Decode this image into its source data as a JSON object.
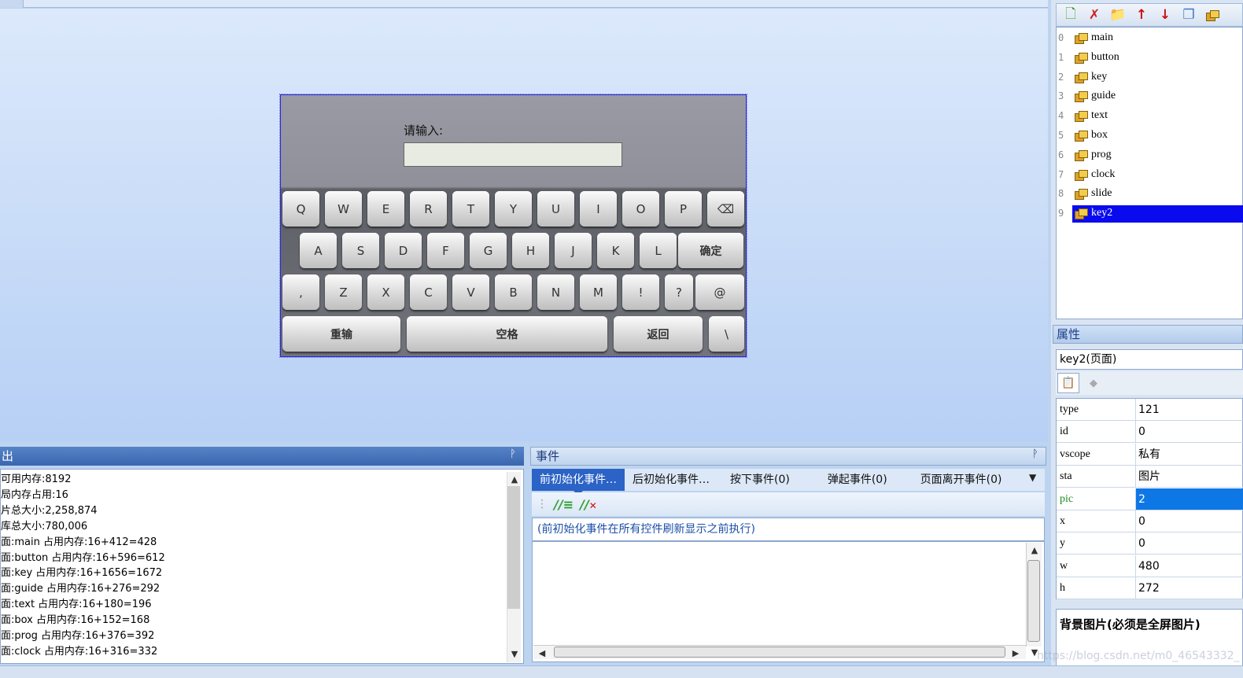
{
  "canvas": {
    "prompt_label": "请输入:",
    "keyboard": {
      "row1": [
        "Q",
        "W",
        "E",
        "R",
        "T",
        "Y",
        "U",
        "I",
        "O",
        "P",
        "⌫"
      ],
      "row2": [
        "A",
        "S",
        "D",
        "F",
        "G",
        "H",
        "J",
        "K",
        "L",
        "确定"
      ],
      "row3": [
        ",",
        "Z",
        "X",
        "C",
        "V",
        "B",
        "N",
        "M",
        "!",
        "?",
        "@"
      ],
      "row4": [
        "重输",
        "空格",
        "返回",
        "\\"
      ]
    }
  },
  "toolbar": {
    "icons": [
      "new-page-icon",
      "delete-page-icon",
      "move-page-icon",
      "arrow-up-icon",
      "arrow-down-icon",
      "copy-page-icon",
      "page-menu-icon"
    ]
  },
  "pages": [
    {
      "index": "0",
      "name": "main"
    },
    {
      "index": "1",
      "name": "button"
    },
    {
      "index": "2",
      "name": "key"
    },
    {
      "index": "3",
      "name": "guide"
    },
    {
      "index": "4",
      "name": "text"
    },
    {
      "index": "5",
      "name": "box"
    },
    {
      "index": "6",
      "name": "prog"
    },
    {
      "index": "7",
      "name": "clock"
    },
    {
      "index": "8",
      "name": "slide"
    },
    {
      "index": "9",
      "name": "key2"
    }
  ],
  "selected_page_index": 9,
  "properties": {
    "title": "属性",
    "selected_object": "key2(页面)",
    "rows": [
      {
        "key": "type",
        "value": "121"
      },
      {
        "key": "id",
        "value": "0"
      },
      {
        "key": "vscope",
        "value": "私有"
      },
      {
        "key": "sta",
        "value": "图片"
      },
      {
        "key": "pic",
        "value": "2"
      },
      {
        "key": "x",
        "value": "0"
      },
      {
        "key": "y",
        "value": "0"
      },
      {
        "key": "w",
        "value": "480"
      },
      {
        "key": "h",
        "value": "272"
      }
    ],
    "selected_row": 4,
    "description": "背景图片(必须是全屏图片)"
  },
  "output": {
    "title": "出",
    "pin": "ᚹ",
    "lines": [
      "可用内存:8192",
      "局内存占用:16",
      "片总大小:2,258,874",
      "库总大小:780,006",
      "面:main 占用内存:16+412=428",
      "面:button 占用内存:16+596=612",
      "面:key 占用内存:16+1656=1672",
      "面:guide 占用内存:16+276=292",
      "面:text 占用内存:16+180=196",
      "面:box 占用内存:16+152=168",
      "面:prog 占用内存:16+376=392",
      "面:clock 占用内存:16+316=332"
    ]
  },
  "events": {
    "title": "事件",
    "pin": "ᚹ",
    "tabs": [
      "前初始化事件…",
      "后初始化事件…",
      "按下事件(0)",
      "弹起事件(0)",
      "页面离开事件(0)"
    ],
    "active_tab": 0,
    "note": "(前初始化事件在所有控件刷新显示之前执行)"
  },
  "status_bar": {
    "text": ""
  },
  "watermark": "https://blog.csdn.net/m0_46543332_"
}
